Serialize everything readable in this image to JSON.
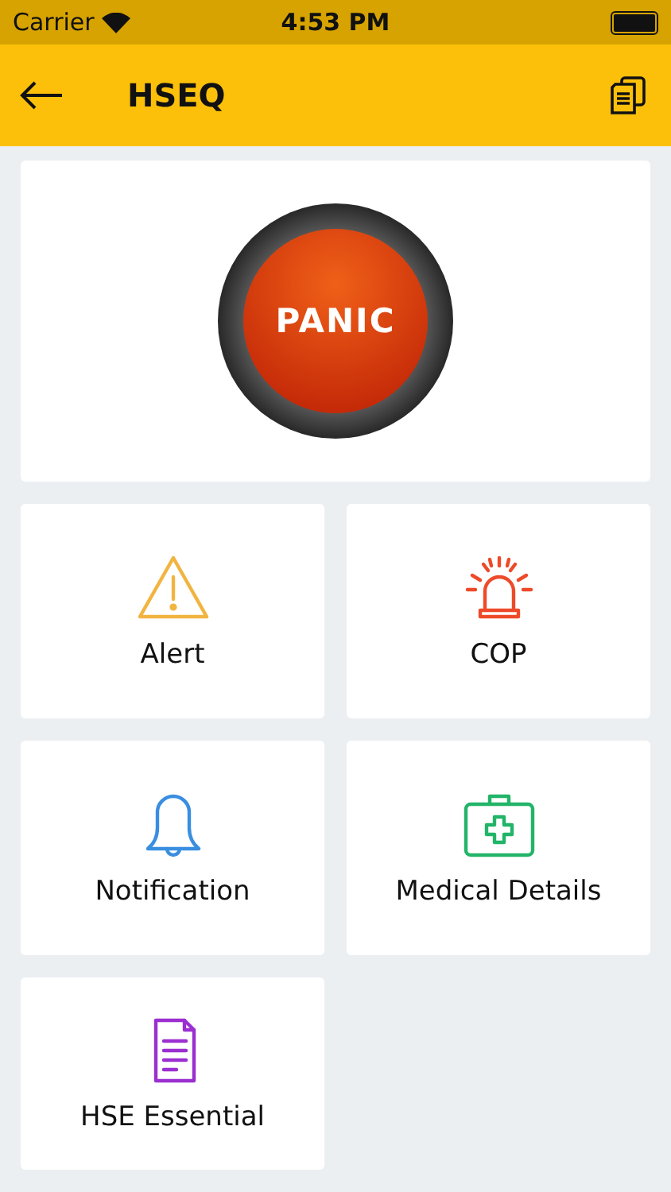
{
  "status_bar": {
    "carrier": "Carrier",
    "time": "4:53 PM"
  },
  "nav": {
    "title": "HSEQ"
  },
  "panic": {
    "label": "PANIC"
  },
  "tiles": [
    {
      "kind": "alert",
      "label": "Alert",
      "color": "#f2b440"
    },
    {
      "kind": "siren",
      "label": "COP",
      "color": "#ee4a2a"
    },
    {
      "kind": "bell",
      "label": "Notification",
      "color": "#3a8ee0"
    },
    {
      "kind": "medkit",
      "label": "Medical Details",
      "color": "#22b468"
    },
    {
      "kind": "document",
      "label": "HSE Essential",
      "color": "#9b2fd0"
    }
  ]
}
